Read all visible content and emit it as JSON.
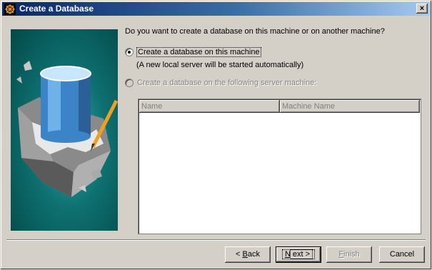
{
  "window": {
    "title": "Create a Database",
    "close_glyph": "×"
  },
  "prompt": {
    "question": "Do you want to create a database on this machine or on another machine?"
  },
  "options": [
    {
      "label": "Create a database on this machine",
      "selected": true,
      "enabled": true,
      "note": "(A new local server will be started automatically)"
    },
    {
      "label": "Create a database on the following server machine:",
      "selected": false,
      "enabled": false
    }
  ],
  "server_list": {
    "columns": [
      "Name",
      "Machine Name"
    ],
    "rows": []
  },
  "buttons": {
    "back": {
      "prefix": "< ",
      "mnemonic": "B",
      "rest": "ack"
    },
    "next": {
      "mnemonic": "N",
      "rest": "ext >"
    },
    "finish": {
      "mnemonic": "F",
      "rest": "inish",
      "enabled": false
    },
    "cancel": "Cancel"
  },
  "colors": {
    "title_start": "#0a246a",
    "title_end": "#a6caf0",
    "art_teal": "#0e7070",
    "face": "#d4d0c8"
  },
  "icons": {
    "app": "database-wizard-icon",
    "close": "close-icon",
    "illustration": "database-cylinder-block-illustration"
  }
}
